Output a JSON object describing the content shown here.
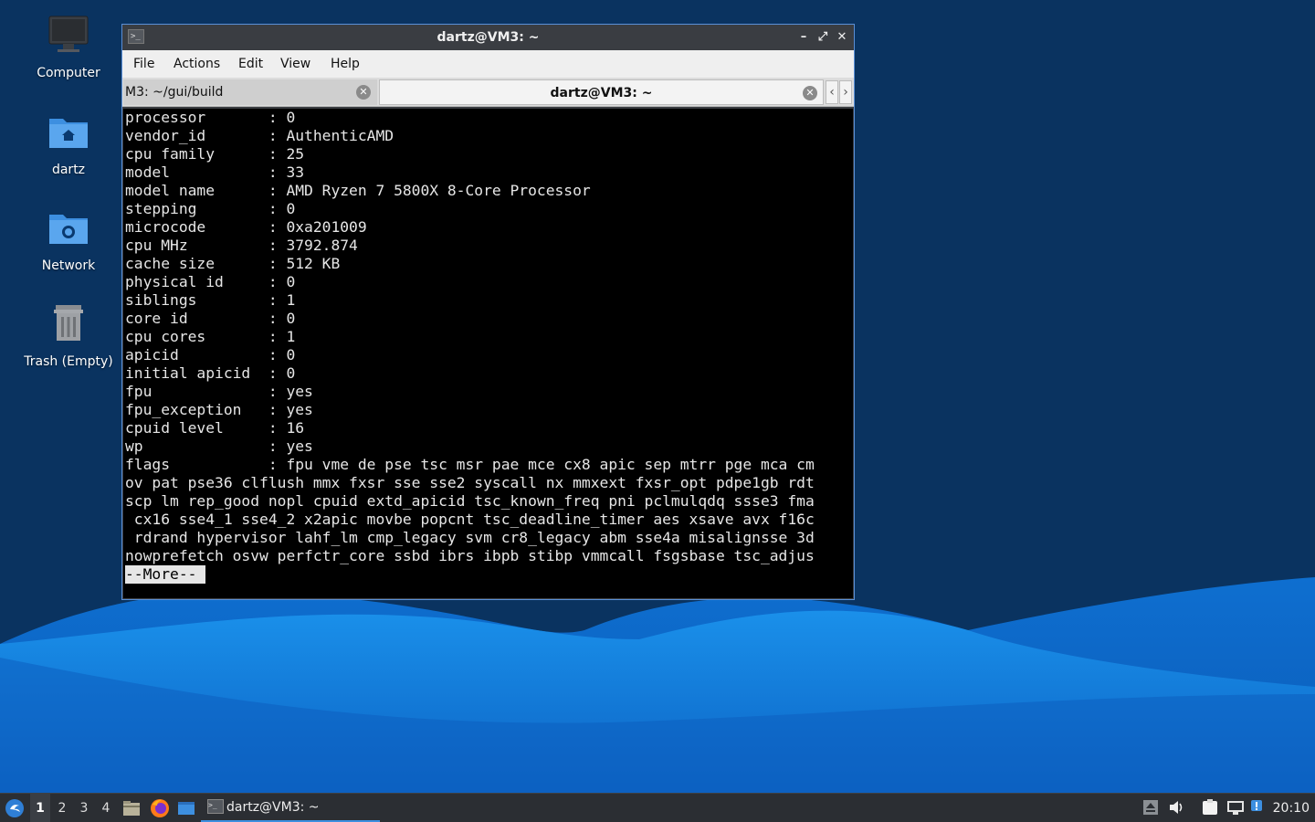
{
  "desktop": {
    "icons": [
      {
        "label": "Computer",
        "icon": "computer-icon"
      },
      {
        "label": "dartz",
        "icon": "home-folder-icon"
      },
      {
        "label": "Network",
        "icon": "network-folder-icon"
      },
      {
        "label": "Trash (Empty)",
        "icon": "trash-icon"
      }
    ]
  },
  "window": {
    "title": "dartz@VM3: ~",
    "menu": [
      "File",
      "Actions",
      "Edit",
      "View",
      "Help"
    ],
    "tabs": [
      {
        "label": "M3: ~/gui/build"
      },
      {
        "label": "dartz@VM3: ~"
      }
    ],
    "terminal_lines": [
      "processor       : 0",
      "vendor_id       : AuthenticAMD",
      "cpu family      : 25",
      "model           : 33",
      "model name      : AMD Ryzen 7 5800X 8-Core Processor",
      "stepping        : 0",
      "microcode       : 0xa201009",
      "cpu MHz         : 3792.874",
      "cache size      : 512 KB",
      "physical id     : 0",
      "siblings        : 1",
      "core id         : 0",
      "cpu cores       : 1",
      "apicid          : 0",
      "initial apicid  : 0",
      "fpu             : yes",
      "fpu_exception   : yes",
      "cpuid level     : 16",
      "wp              : yes",
      "flags           : fpu vme de pse tsc msr pae mce cx8 apic sep mtrr pge mca cm",
      "ov pat pse36 clflush mmx fxsr sse sse2 syscall nx mmxext fxsr_opt pdpe1gb rdt",
      "scp lm rep_good nopl cpuid extd_apicid tsc_known_freq pni pclmulqdq ssse3 fma",
      " cx16 sse4_1 sse4_2 x2apic movbe popcnt tsc_deadline_timer aes xsave avx f16c",
      " rdrand hypervisor lahf_lm cmp_legacy svm cr8_legacy abm sse4a misalignsse 3d",
      "nowprefetch osvw perfctr_core ssbd ibrs ibpb stibp vmmcall fsgsbase tsc_adjus"
    ],
    "more_prompt": "--More--"
  },
  "taskbar": {
    "workspaces": [
      "1",
      "2",
      "3",
      "4"
    ],
    "active_workspace": "1",
    "task_label": "dartz@VM3: ~",
    "clock": "20:10"
  },
  "colors": {
    "accent": "#3d8fe0",
    "desktop_dark": "#0a3360",
    "wave_light": "#1a8ae8",
    "terminal_bg": "#000000",
    "terminal_fg": "#e6e6e6"
  }
}
